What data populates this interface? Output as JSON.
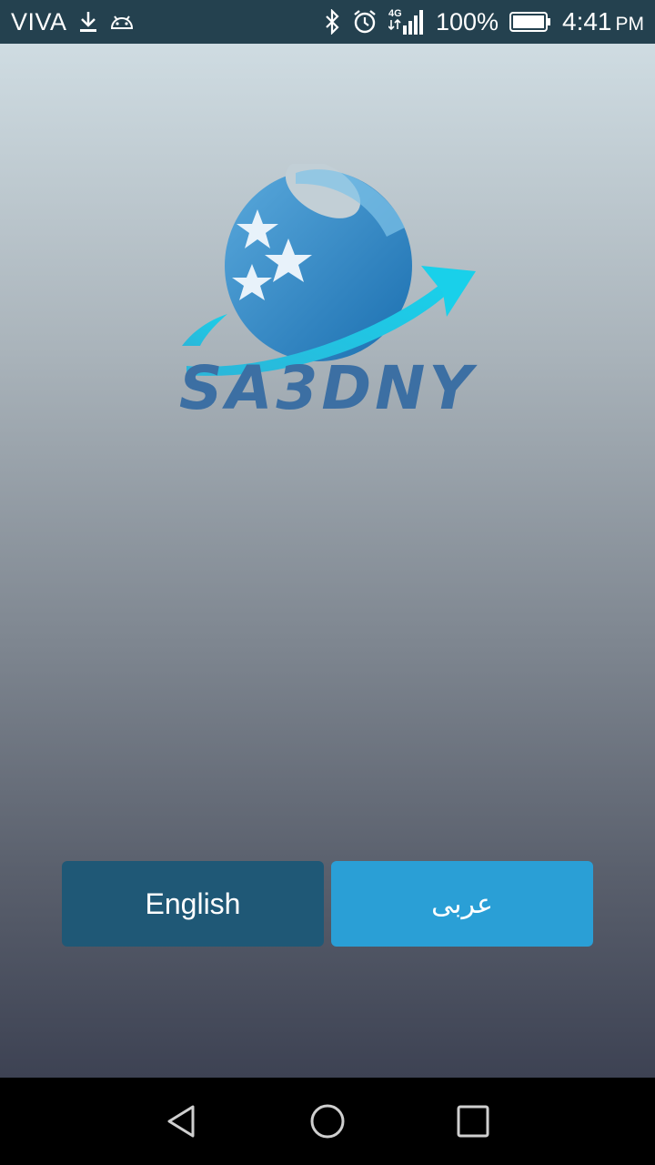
{
  "status_bar": {
    "carrier": "VIVA",
    "network": "4G",
    "battery": "100%",
    "time": "4:41",
    "time_suffix": "PM",
    "icons": [
      "download-icon",
      "android-icon",
      "bluetooth-icon",
      "alarm-icon",
      "signal-icon",
      "battery-icon"
    ]
  },
  "brand": {
    "name": "SA3DNY",
    "colors": {
      "primary": "#3c6fa3",
      "accent": "#22c6e0"
    }
  },
  "language_buttons": {
    "english_label": "English",
    "arabic_label": "عربى",
    "english_color": "#1f5876",
    "arabic_color": "#2a9fd6"
  },
  "nav_bar": {
    "icons": [
      "back-icon",
      "home-icon",
      "recents-icon"
    ]
  }
}
